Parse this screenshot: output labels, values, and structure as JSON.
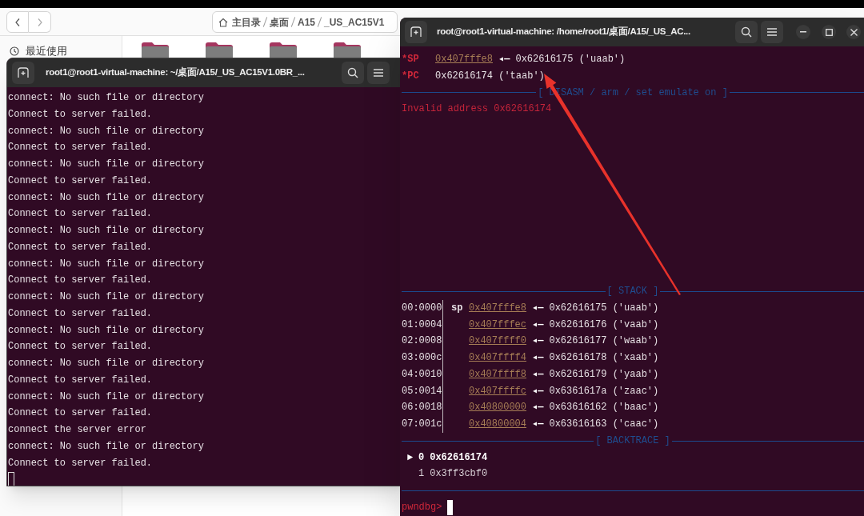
{
  "file_manager": {
    "path": [
      "主目录",
      "桌面",
      "A15",
      "_US_AC15V1"
    ],
    "sidebar": [
      {
        "label": "最近使用"
      }
    ]
  },
  "terminal_left": {
    "title": "root1@root1-virtual-machine: ~/桌面/A15/_US_AC15V1.0BR_...",
    "lines": [
      "connect: No such file or directory",
      "Connect to server failed.",
      "connect: No such file or directory",
      "Connect to server failed.",
      "connect: No such file or directory",
      "Connect to server failed.",
      "connect: No such file or directory",
      "Connect to server failed.",
      "connect: No such file or directory",
      "Connect to server failed.",
      "connect: No such file or directory",
      "Connect to server failed.",
      "connect: No such file or directory",
      "Connect to server failed.",
      "connect: No such file or directory",
      "Connect to server failed.",
      "connect: No such file or directory",
      "Connect to server failed.",
      "connect: No such file or directory",
      "Connect to server failed.",
      "connect the server error",
      "connect: No such file or directory",
      "Connect to server failed."
    ]
  },
  "terminal_right": {
    "title": "root@root1-virtual-machine: /home/root1/桌面/A15/_US_AC...",
    "registers": [
      {
        "name": "*SP",
        "address": "0x407fffe8",
        "arrow": "◂—",
        "value": "0x62616175 ('uaab')"
      },
      {
        "name": "*PC",
        "value": "0x62616174 ('taab')"
      }
    ],
    "disasm_header": "[ DISASM / arm / set emulate on ]",
    "disasm_lines": [
      "Invalid address 0x62616174"
    ],
    "stack_header": "[ STACK ]",
    "stack": [
      {
        "offset": "00:0000",
        "reg": "sp",
        "address": "0x407fffe8",
        "arrow": "◂—",
        "value": "0x62616175 ('uaab')"
      },
      {
        "offset": "01:0004",
        "address": "0x407fffec",
        "arrow": "◂—",
        "value": "0x62616176 ('vaab')"
      },
      {
        "offset": "02:0008",
        "address": "0x407ffff0",
        "arrow": "◂—",
        "value": "0x62616177 ('waab')"
      },
      {
        "offset": "03:000c",
        "address": "0x407ffff4",
        "arrow": "◂—",
        "value": "0x62616178 ('xaab')"
      },
      {
        "offset": "04:0010",
        "address": "0x407ffff8",
        "arrow": "◂—",
        "value": "0x62616179 ('yaab')"
      },
      {
        "offset": "05:0014",
        "address": "0x407ffffc",
        "arrow": "◂—",
        "value": "0x6361617a ('zaac')"
      },
      {
        "offset": "06:0018",
        "address": "0x40800000",
        "arrow": "◂—",
        "value": "0x63616162 ('baac')"
      },
      {
        "offset": "07:001c",
        "address": "0x40800004",
        "arrow": "◂—",
        "value": "0x63616163 ('caac')"
      }
    ],
    "backtrace_header": "[ BACKTRACE ]",
    "backtrace": [
      {
        "selected": true,
        "marker": "►",
        "frame": "0",
        "address": "0x62616174"
      },
      {
        "selected": false,
        "frame": "1",
        "address": "0x3ff3cbf0"
      }
    ],
    "prompt": "pwndbg>"
  }
}
